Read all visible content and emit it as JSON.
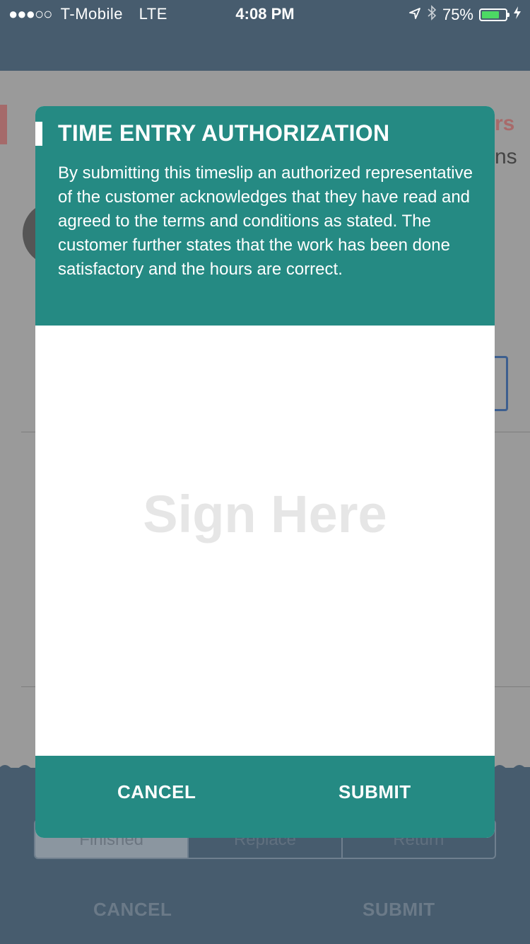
{
  "status_bar": {
    "signal_dots": "●●●○○",
    "carrier": "T-Mobile",
    "network": "LTE",
    "time": "4:08 PM",
    "battery_percent": "75%",
    "battery_level": 0.75
  },
  "background": {
    "title_fragment": "rs",
    "subtitle_fragment": "ns",
    "segments": [
      "Finished",
      "Replace",
      "Return"
    ],
    "footer_cancel": "CANCEL",
    "footer_submit": "SUBMIT"
  },
  "modal": {
    "title": "TIME ENTRY AUTHORIZATION",
    "body": "By submitting this timeslip an authorized representative of the customer acknowledges that they have read and agreed to the terms and conditions as stated. The customer further states that the work has been done satisfactory and the hours are correct.",
    "signature_placeholder": "Sign Here",
    "cancel_label": "CANCEL",
    "submit_label": "SUBMIT"
  },
  "colors": {
    "teal": "#258a83",
    "navy": "#475c6e"
  }
}
